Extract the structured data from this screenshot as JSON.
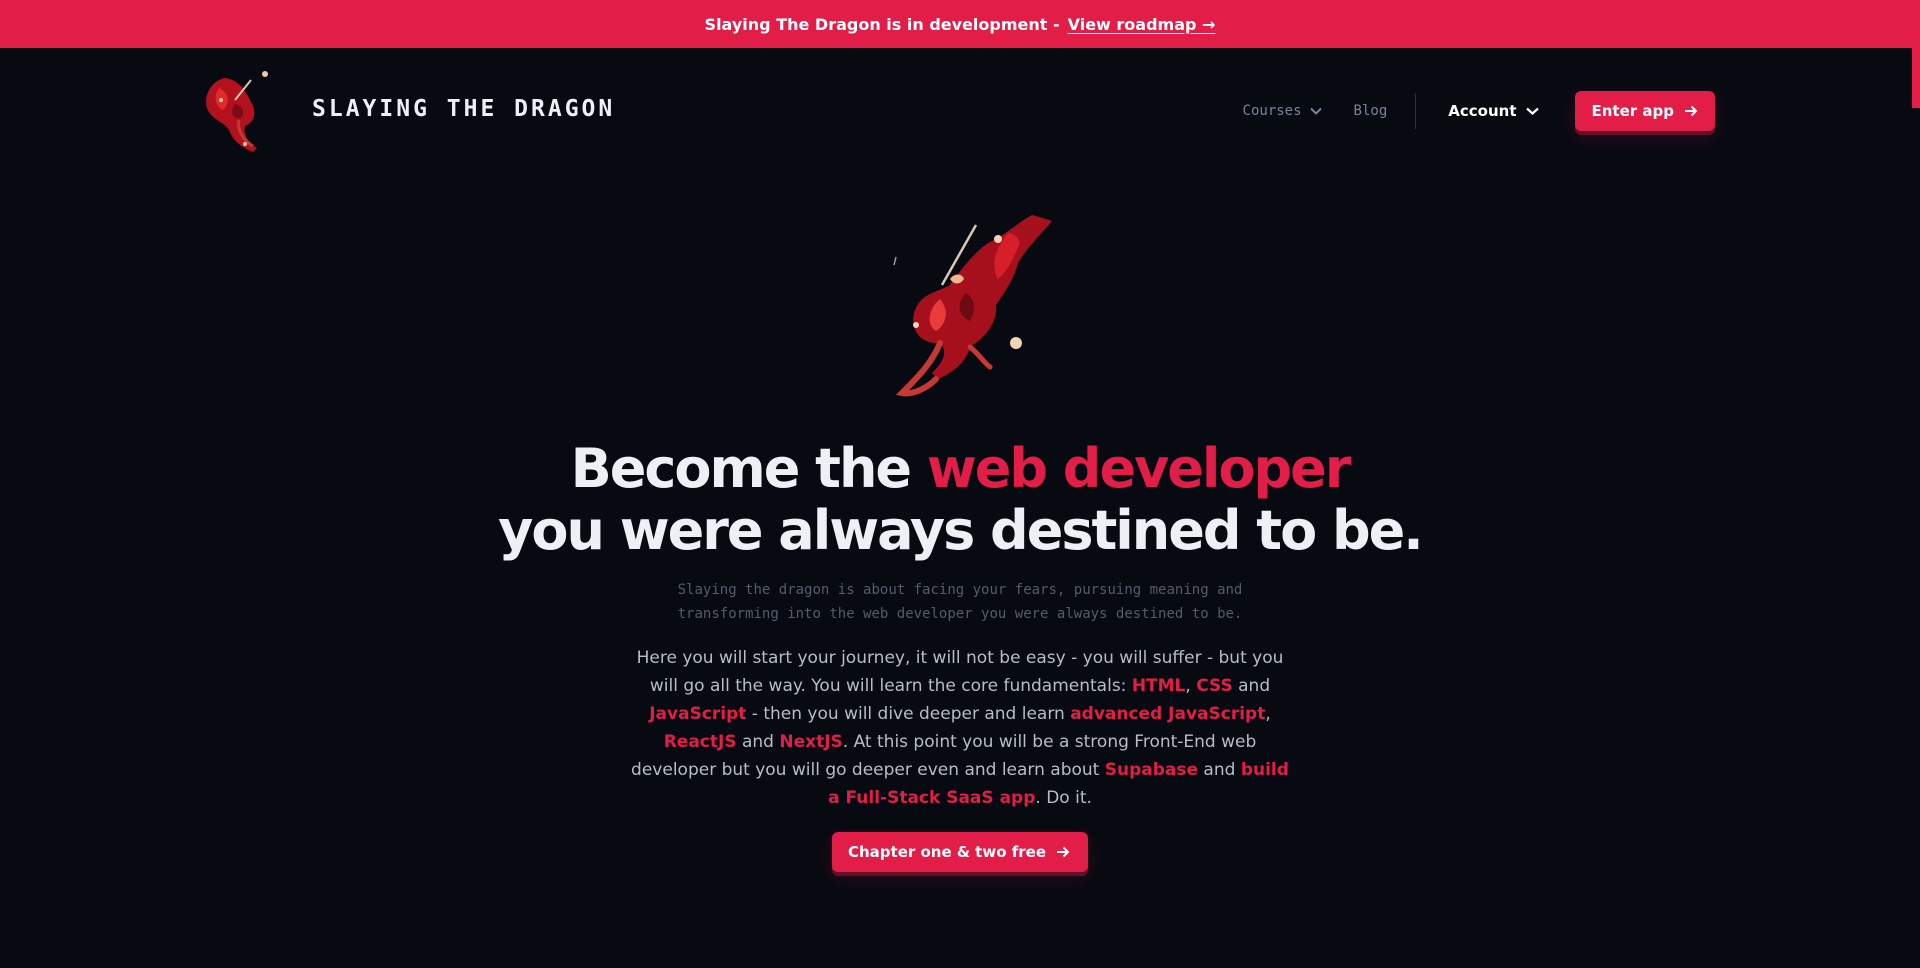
{
  "colors": {
    "accent": "#e11d48",
    "background": "#080a12",
    "heading": "#eef0f6",
    "muted": "#79829a"
  },
  "banner": {
    "text": "Slaying The Dragon is in development -",
    "link": "View roadmap →"
  },
  "header": {
    "brand": "SLAYING THE DRAGON",
    "logo_icon": "dragon-logo-icon",
    "nav": {
      "courses": "Courses",
      "blog": "Blog",
      "account": "Account",
      "chevron_icon": "chevron-down-icon"
    },
    "enter_app": "Enter app",
    "arrow_icon": "arrow-right-icon"
  },
  "hero": {
    "image_icon": "dragon-illustration-icon",
    "headline_part1": "Become the",
    "headline_accent": "web developer",
    "headline_line2": "you were always destined to be.",
    "subtitle_line1": "Slaying the dragon is about facing your fears, pursuing meaning and",
    "subtitle_line2": "transforming into the web developer you were always destined to be.",
    "intro": {
      "t1": "Here you will start your journey, it will not be easy - you will suffer - but you will go all the way. You will learn the core fundamentals: ",
      "h_html": "HTML",
      "t2": ", ",
      "h_css": "CSS",
      "t3": " and ",
      "h_js": "JavaScript",
      "t4": " - then you will dive deeper and learn ",
      "h_adv_js": "advanced JavaScript",
      "t5": ", ",
      "h_react": "ReactJS",
      "t6": " and ",
      "h_next": "NextJS",
      "t7": ". At this point you will be a strong Front-End web developer but you will go deeper even and learn about ",
      "h_supabase": "Supabase",
      "t8": " and ",
      "h_saas": "build a Full-Stack SaaS app",
      "t9": ". Do it."
    },
    "cta": "Chapter one & two free"
  }
}
